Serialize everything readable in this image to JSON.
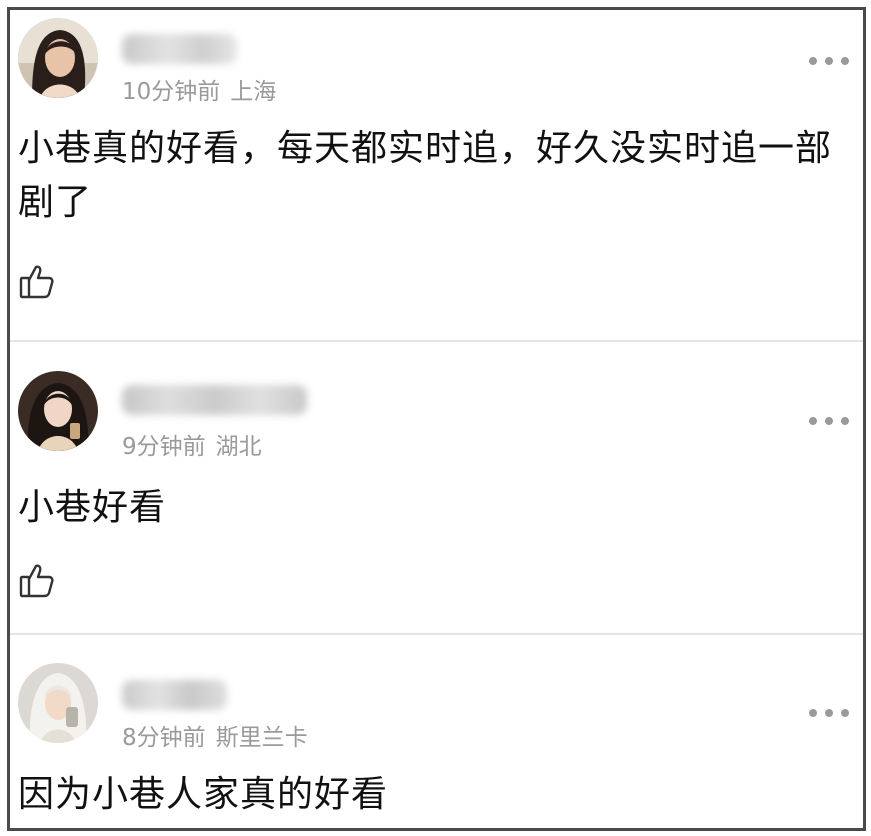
{
  "comments": [
    {
      "time": "10分钟前",
      "location": "上海",
      "text": "小巷真的好看，每天都实时追，好久没实时追一部剧了",
      "avatar_icon": "user-avatar-photo",
      "more_icon": "more-dots-icon",
      "like_icon": "thumbs-up-icon"
    },
    {
      "time": "9分钟前",
      "location": "湖北",
      "text": "小巷好看",
      "avatar_icon": "user-avatar-photo",
      "more_icon": "more-dots-icon",
      "like_icon": "thumbs-up-icon"
    },
    {
      "time": "8分钟前",
      "location": "斯里兰卡",
      "text": "因为小巷人家真的好看",
      "avatar_icon": "user-avatar-photo",
      "more_icon": "more-dots-icon"
    }
  ],
  "colors": {
    "border": "#4a4a4a",
    "meta_text": "#9a9a9a",
    "body_text": "#111111",
    "divider": "#e4e4e4"
  }
}
